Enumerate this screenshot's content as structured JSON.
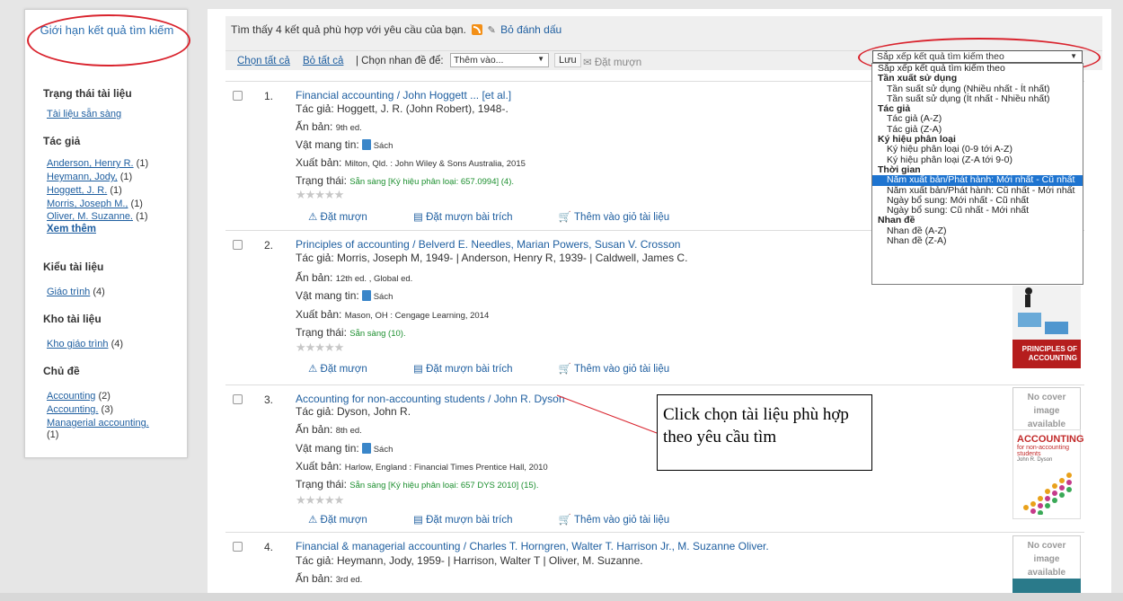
{
  "sidebar": {
    "title": "Giới hạn kết quả tìm kiếm",
    "facets": [
      {
        "heading": "Trạng thái tài liệu",
        "items": [
          {
            "label": "Tài liệu sẵn sàng",
            "count": ""
          }
        ]
      },
      {
        "heading": "Tác giả",
        "items": [
          {
            "label": "Anderson, Henry R.",
            "count": "(1)"
          },
          {
            "label": "Heymann, Jody,",
            "count": "(1)"
          },
          {
            "label": "Hoggett, J. R.",
            "count": "(1)"
          },
          {
            "label": "Morris, Joseph M.,",
            "count": "(1)"
          },
          {
            "label": "Oliver, M. Suzanne.",
            "count": "(1)"
          }
        ],
        "more": "Xem thêm"
      },
      {
        "heading": "Kiểu tài liệu",
        "items": [
          {
            "label": "Giáo trình",
            "count": "(4)"
          }
        ]
      },
      {
        "heading": "Kho tài liệu",
        "items": [
          {
            "label": "Kho giáo trình",
            "count": "(4)"
          }
        ]
      },
      {
        "heading": "Chủ đề",
        "items": [
          {
            "label": "Accounting",
            "count": "(2)"
          },
          {
            "label": "Accounting.",
            "count": "(3)"
          },
          {
            "label": "Managerial accounting.",
            "count": "(1)"
          }
        ]
      }
    ]
  },
  "results_header": {
    "found_text": "Tìm thấy 4 kết quả phù hợp với yêu cầu của bạn.",
    "bookmark_label": "Bỏ đánh dấu"
  },
  "toolbar": {
    "select_all": "Chọn tất cả",
    "clear_all": "Bỏ tất cả",
    "tag_label": "| Chọn nhan đề để:",
    "tag_select": "Thêm vào...",
    "save": "Lưu",
    "place_hold": "Đặt mượn"
  },
  "sort": {
    "selected": "Sắp xếp kết quả tìm kiếm theo",
    "options": [
      {
        "type": "first",
        "label": "Sắp xếp kết quả tìm kiếm theo"
      },
      {
        "type": "group",
        "label": "Tần xuất sử dụng"
      },
      {
        "type": "item",
        "label": "Tần suất sử dụng (Nhiều nhất - Ít nhất)"
      },
      {
        "type": "item",
        "label": "Tần suất sử dụng (Ít nhất - Nhiều nhất)"
      },
      {
        "type": "group",
        "label": "Tác giả"
      },
      {
        "type": "item",
        "label": "Tác giả (A-Z)"
      },
      {
        "type": "item",
        "label": "Tác giả (Z-A)"
      },
      {
        "type": "group",
        "label": "Ký hiệu phân loại"
      },
      {
        "type": "item",
        "label": "Ký hiệu phân loại (0-9 tới A-Z)"
      },
      {
        "type": "item",
        "label": "Ký hiệu phân loại (Z-A tới 9-0)"
      },
      {
        "type": "group",
        "label": "Thời gian"
      },
      {
        "type": "selected",
        "label": "Năm xuất bản/Phát hành: Mới nhất - Cũ nhất"
      },
      {
        "type": "item",
        "label": "Năm xuất bản/Phát hành: Cũ nhất - Mới nhất"
      },
      {
        "type": "item",
        "label": "Ngày bổ sung: Mới nhất - Cũ nhất"
      },
      {
        "type": "item",
        "label": "Ngày bổ sung: Cũ nhất - Mới nhất"
      },
      {
        "type": "group",
        "label": "Nhan đề"
      },
      {
        "type": "item",
        "label": "Nhan đề (A-Z)"
      },
      {
        "type": "item",
        "label": "Nhan đề (Z-A)"
      }
    ]
  },
  "labels": {
    "edition": "Ấn bản:",
    "media": "Vật mang tin:",
    "media_value": "Sách",
    "publisher": "Xuất bản:",
    "status": "Trạng thái:",
    "hold": "Đặt mượn",
    "article_hold": "Đặt mượn bài trích",
    "add_cart": "Thêm vào giỏ tài liệu",
    "stars": "★★★★★",
    "no_cover": [
      "No cover",
      "image",
      "available"
    ]
  },
  "records": [
    {
      "num": "1.",
      "title": "Financial accounting / John Hoggett ... [et al.]",
      "author": "Tác giả: Hoggett, J. R. (John Robert), 1948-.",
      "edition": "9th ed.",
      "publisher": "Milton, Qld. : John Wiley & Sons Australia, 2015",
      "status": "Sẵn sàng [Ký hiệu phân loại: 657.0994] (4)."
    },
    {
      "num": "2.",
      "title": "Principles of accounting / Belverd E. Needles, Marian Powers, Susan V. Crosson",
      "author": "Tác giả: Morris, Joseph M, 1949- | Anderson, Henry R, 1939- | Caldwell, James C.",
      "edition": "12th ed. , Global ed.",
      "publisher": "Mason, OH : Cengage Learning, 2014",
      "status": "Sẵn sàng (10)."
    },
    {
      "num": "3.",
      "title": "Accounting for non-accounting students / John R. Dyson",
      "author": "Tác giả: Dyson, John R.",
      "edition": "8th ed.",
      "publisher": "Harlow, England : Financial Times Prentice Hall, 2010",
      "status": "Sẵn sàng [Ký hiệu phân loại: 657 DYS 2010] (15)."
    },
    {
      "num": "4.",
      "title": "Financial & managerial accounting / Charles T. Horngren, Walter T. Harrison Jr., M. Suzanne Oliver.",
      "author": "Tác giả: Heymann, Jody, 1959- | Harrison, Walter T | Oliver, M. Suzanne.",
      "edition": "3rd ed."
    }
  ],
  "covers": {
    "rec2_caption": "PRINCIPLES OF ACCOUNTING",
    "rec3_caption": "ACCOUNTING",
    "rec3_sub": "for non-accounting students",
    "rec3_author": "John R. Dyson"
  },
  "annotation": "Click chọn tài liệu phù hợp theo yêu cầu tìm",
  "colors": {
    "accent": "#1f5fa0",
    "highlight": "#d9232d",
    "selected": "#1e74d0",
    "available": "#1c8f2f"
  }
}
